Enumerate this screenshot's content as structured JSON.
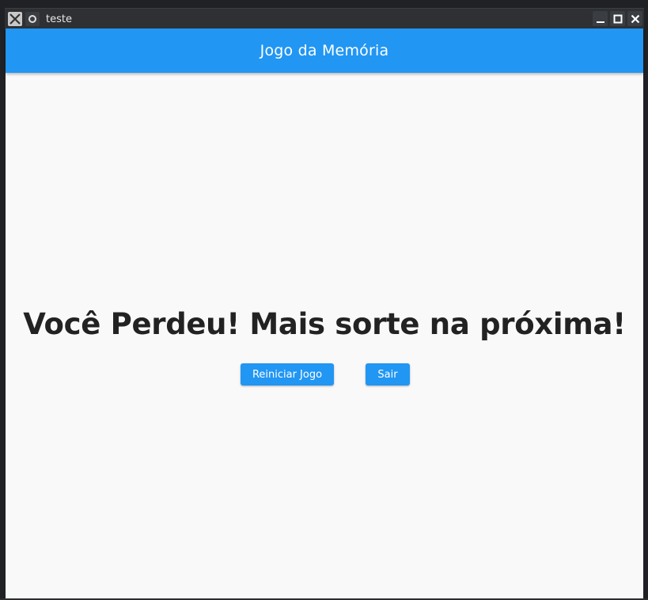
{
  "window": {
    "title": "teste",
    "app_icon": "x-window-icon",
    "pin_icon": "sticky-icon",
    "controls": [
      "minimize-icon",
      "maximize-icon",
      "close-icon"
    ]
  },
  "appbar": {
    "title": "Jogo da Memória",
    "color": "#2196f3"
  },
  "main": {
    "message": "Você Perdeu! Mais sorte na próxima!",
    "restart_label": "Reiniciar Jogo",
    "exit_label": "Sair"
  }
}
